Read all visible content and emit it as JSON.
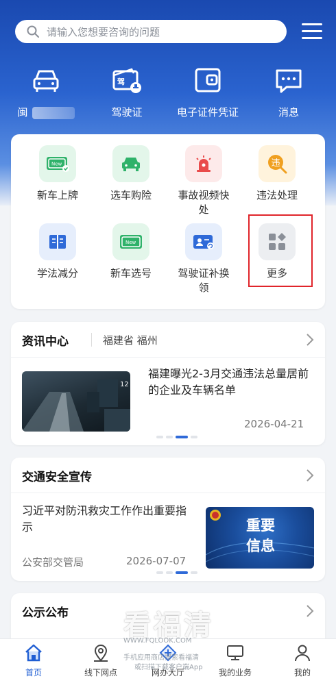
{
  "search": {
    "placeholder": "请输入您想要咨询的问题"
  },
  "top_nav": [
    {
      "label": "闽",
      "icon": "car-icon"
    },
    {
      "label": "驾驶证",
      "icon": "license-icon"
    },
    {
      "label": "电子证件凭证",
      "icon": "wallet-icon"
    },
    {
      "label": "消息",
      "icon": "message-icon"
    }
  ],
  "services": [
    {
      "label": "新车上牌",
      "icon": "new-plate-icon",
      "color": "#2fb26a"
    },
    {
      "label": "选车购险",
      "icon": "car-insurance-icon",
      "color": "#2fb26a"
    },
    {
      "label": "事故视频快处",
      "icon": "alarm-icon",
      "color": "#e94b4b"
    },
    {
      "label": "违法处理",
      "icon": "violation-icon",
      "color": "#f0a020"
    },
    {
      "label": "学法减分",
      "icon": "book-icon",
      "color": "#2f6ad8"
    },
    {
      "label": "新车选号",
      "icon": "plate-select-icon",
      "color": "#2fb26a"
    },
    {
      "label": "驾驶证补换领",
      "icon": "id-card-icon",
      "color": "#2f6ad8"
    },
    {
      "label": "更多",
      "icon": "grid-icon",
      "color": "#8a8f98"
    }
  ],
  "news_center": {
    "title": "资讯中心",
    "region": "福建省 福州",
    "item_title": "福建曝光2-3月交通违法总量居前的企业及车辆名单",
    "item_date": "2026-04-21"
  },
  "safety": {
    "title": "交通安全宣传",
    "item_title": "习近平对防汛救灾工作作出重要指示",
    "item_source": "公安部交管局",
    "item_date": "2026-07-07",
    "thumb_text": "重要信息"
  },
  "notice": {
    "title": "公示公布"
  },
  "tabs": [
    {
      "label": "首页",
      "icon": "home-icon",
      "active": true
    },
    {
      "label": "线下网点",
      "icon": "location-icon",
      "active": false
    },
    {
      "label": "网办大厅",
      "icon": "hall-icon",
      "active": false
    },
    {
      "label": "我的业务",
      "icon": "monitor-icon",
      "active": false
    },
    {
      "label": "我的",
      "icon": "user-icon",
      "active": false
    }
  ],
  "watermark": {
    "title": "看福清",
    "url": "WWW.FQLOOK.COM",
    "line2": "手机应用商店搜索看福清",
    "line3": "或扫描下载客户端App"
  }
}
